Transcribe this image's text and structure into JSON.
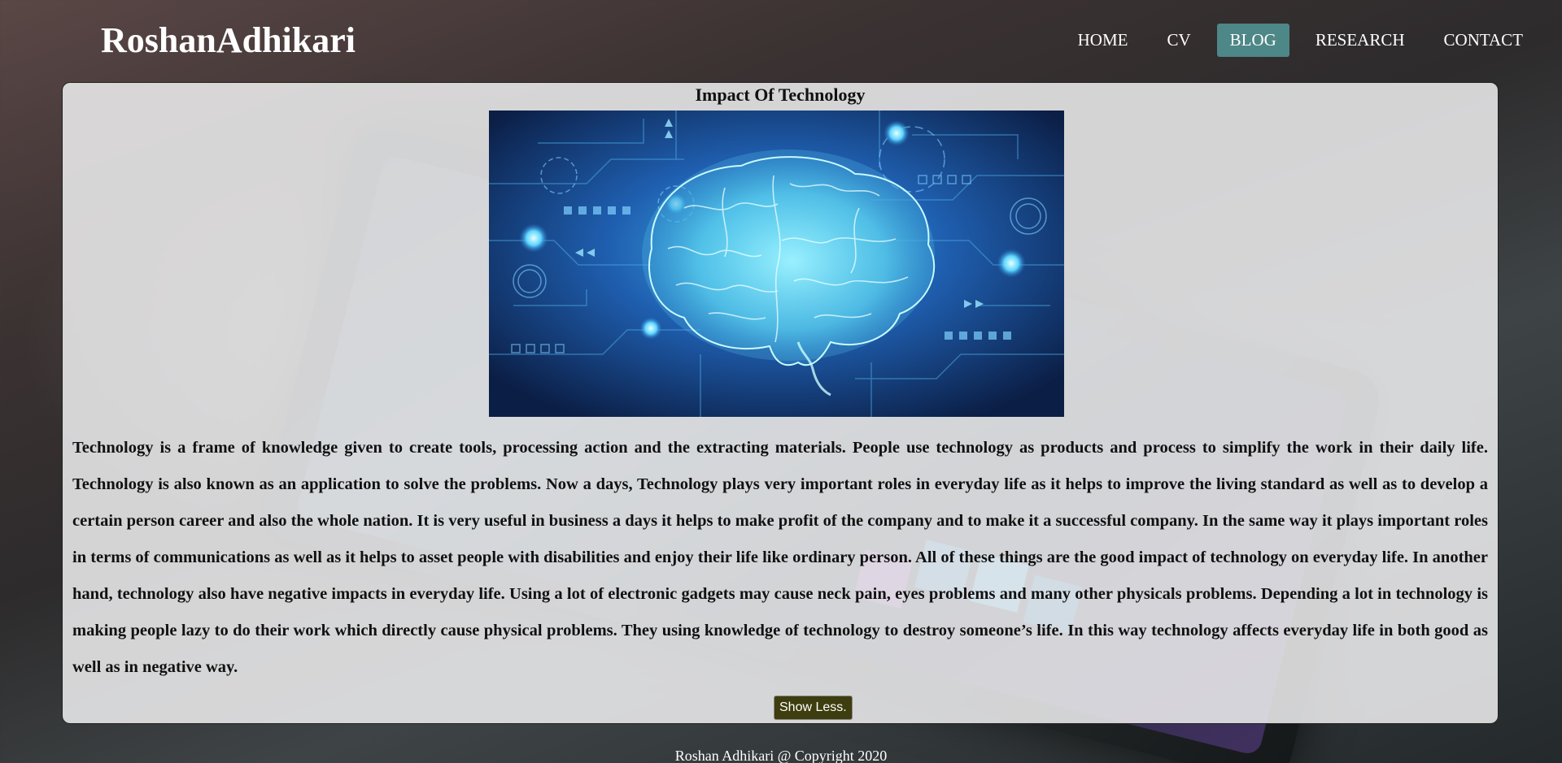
{
  "header": {
    "logo": "RoshanAdhikari",
    "nav": [
      {
        "label": "HOME",
        "active": false
      },
      {
        "label": "CV",
        "active": false
      },
      {
        "label": "BLOG",
        "active": true
      },
      {
        "label": "RESEARCH",
        "active": false
      },
      {
        "label": "CONTACT",
        "active": false
      }
    ]
  },
  "post": {
    "title": "Impact Of Technology",
    "image": "brain-circuit-illustration",
    "body": "Technology is a frame of knowledge given to create tools, processing action and the extracting materials. People use technology as products and process to simplify the work in their daily life. Technology is also known as an application to solve the problems. Now a days, Technology plays very important roles in everyday life as it helps to improve the living standard as well as to develop a certain person career and also the whole nation. It is very useful in business a days it helps to make profit of the company and to make it a successful company. In the same way it plays important roles in terms of communications as well as it helps to asset people with disabilities and enjoy their life like ordinary person. All of these things are the good impact of technology on everyday life. In another hand, technology also have negative impacts in everyday life. Using a lot of electronic gadgets may cause neck pain, eyes problems and many other physicals problems. Depending a lot in technology is making people lazy to do their work which directly cause physical problems. They using knowledge of technology to destroy someone’s life. In this way technology affects everyday life in both good as well as in negative way.",
    "toggle_label": "Show Less."
  },
  "footer": {
    "copyright": "Roshan Adhikari @ Copyright 2020"
  },
  "colors": {
    "nav_active": "#4e8787",
    "button_bg": "#3d3d0f",
    "card_bg": "#ececed"
  }
}
